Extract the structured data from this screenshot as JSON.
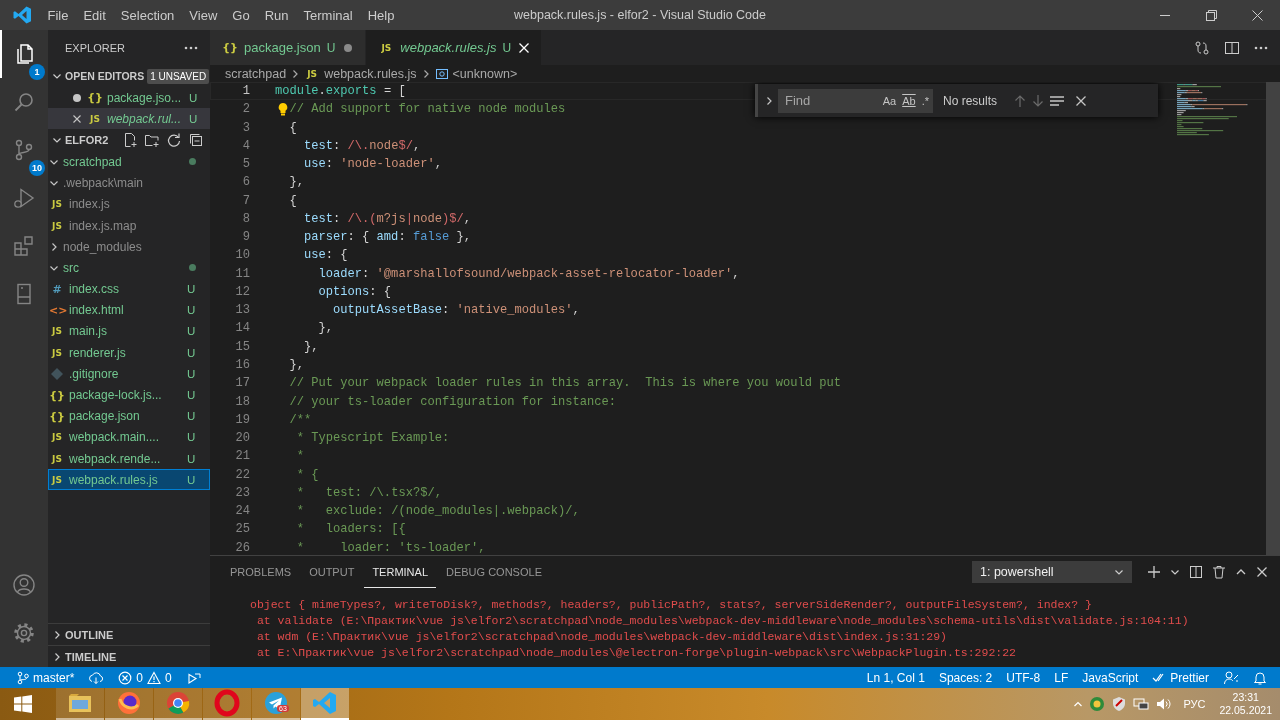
{
  "title_bar": {
    "menu": [
      "File",
      "Edit",
      "Selection",
      "View",
      "Go",
      "Run",
      "Terminal",
      "Help"
    ],
    "title": "webpack.rules.js - elfor2 - Visual Studio Code"
  },
  "activity_bar": {
    "items": [
      {
        "kind": "explorer",
        "selected": true,
        "badge": "1"
      },
      {
        "kind": "search",
        "selected": false
      },
      {
        "kind": "source_control",
        "selected": false,
        "badge": "10"
      },
      {
        "kind": "run",
        "selected": false
      },
      {
        "kind": "extensions",
        "selected": false
      },
      {
        "kind": "remote",
        "selected": false
      }
    ],
    "bottom": [
      {
        "kind": "account"
      },
      {
        "kind": "settings"
      }
    ]
  },
  "sidebar": {
    "title": "EXPLORER",
    "open_editors": {
      "label": "OPEN EDITORS",
      "expanded": true,
      "badge": "1 UNSAVED",
      "items": [
        {
          "name": "package.jso...",
          "kind": "json",
          "icon": "{}",
          "badge": "U",
          "dirty": true,
          "preview": false,
          "selected": false
        },
        {
          "name": "webpack.rul...",
          "kind": "js",
          "icon": "JS",
          "badge": "U",
          "dirty": false,
          "preview": true,
          "selected": true
        }
      ]
    },
    "folder": {
      "name": "ELFOR2",
      "expanded": true,
      "tree": [
        {
          "name": "scratchpad",
          "kind": "folder",
          "expanded": true,
          "ignored": false,
          "dot": true,
          "selected": false,
          "children": [
            {
              "name": ".webpack\\main",
              "kind": "folder",
              "expanded": true,
              "ignored": true,
              "dot": false,
              "selected": false,
              "children": [
                {
                  "name": "index.js",
                  "kind": "js",
                  "icon": "JS",
                  "ignored": true,
                  "selected": false
                },
                {
                  "name": "index.js.map",
                  "kind": "js",
                  "icon": "JS",
                  "ignored": true,
                  "selected": false
                }
              ]
            },
            {
              "name": "node_modules",
              "kind": "folder",
              "expanded": false,
              "ignored": true,
              "dot": false,
              "selected": false
            },
            {
              "name": "src",
              "kind": "folder",
              "expanded": true,
              "ignored": false,
              "dot": true,
              "selected": false,
              "children": [
                {
                  "name": "index.css",
                  "kind": "css",
                  "icon": "#",
                  "ignored": false,
                  "badge": "U",
                  "selected": false
                },
                {
                  "name": "index.html",
                  "kind": "html",
                  "icon": "<>",
                  "ignored": false,
                  "badge": "U",
                  "selected": false
                },
                {
                  "name": "main.js",
                  "kind": "js",
                  "icon": "JS",
                  "ignored": false,
                  "badge": "U",
                  "selected": false
                },
                {
                  "name": "renderer.js",
                  "kind": "js",
                  "icon": "JS",
                  "ignored": false,
                  "badge": "U",
                  "selected": false
                }
              ]
            },
            {
              "name": ".gitignore",
              "kind": "git",
              "ignored": false,
              "badge": "U",
              "selected": false
            },
            {
              "name": "package-lock.js...",
              "kind": "json",
              "icon": "{}",
              "ignored": false,
              "badge": "U",
              "selected": false
            },
            {
              "name": "package.json",
              "kind": "json",
              "icon": "{}",
              "ignored": false,
              "badge": "U",
              "selected": false
            },
            {
              "name": "webpack.main....",
              "kind": "js",
              "icon": "JS",
              "ignored": false,
              "badge": "U",
              "selected": false
            },
            {
              "name": "webpack.rende...",
              "kind": "js",
              "icon": "JS",
              "ignored": false,
              "badge": "U",
              "selected": false
            },
            {
              "name": "webpack.rules.js",
              "kind": "js",
              "icon": "JS",
              "ignored": false,
              "badge": "U",
              "selected": true
            }
          ]
        }
      ]
    },
    "sections": [
      {
        "label": "OUTLINE",
        "expanded": false
      },
      {
        "label": "TIMELINE",
        "expanded": false
      }
    ]
  },
  "tabs": [
    {
      "name": "package.json",
      "kind": "json",
      "icon": "{}",
      "badge": "U",
      "dirty": true,
      "preview": false,
      "selected": false
    },
    {
      "name": "webpack.rules.js",
      "kind": "js",
      "icon": "JS",
      "badge": "U",
      "dirty": false,
      "preview": true,
      "selected": true
    }
  ],
  "breadcrumbs": [
    {
      "kind": "folder",
      "label": "scratchpad"
    },
    {
      "kind": "js",
      "icon": "JS",
      "label": "webpack.rules.js"
    },
    {
      "kind": "symbol",
      "label": "<unknown>"
    }
  ],
  "code": [
    {
      "number": "1",
      "current": true,
      "tokens": [
        {
          "kind": "var",
          "text": "module"
        },
        {
          "kind": "p",
          "text": "."
        },
        {
          "kind": "var",
          "text": "exports"
        },
        {
          "kind": "p",
          "text": " = ["
        }
      ]
    },
    {
      "number": "2",
      "current": false,
      "lightbulb": true,
      "tokens": [
        {
          "kind": "com",
          "text": "  // Add support for native node modules"
        }
      ]
    },
    {
      "number": "3",
      "current": false,
      "tokens": [
        {
          "kind": "p",
          "text": "  {"
        }
      ]
    },
    {
      "number": "4",
      "current": false,
      "tokens": [
        {
          "kind": "prop",
          "text": "    test"
        },
        {
          "kind": "p",
          "text": ": "
        },
        {
          "kind": "re",
          "text": "/\\."
        },
        {
          "kind": "str",
          "text": "node"
        },
        {
          "kind": "re",
          "text": "$/"
        },
        {
          "kind": "p",
          "text": ","
        }
      ]
    },
    {
      "number": "5",
      "current": false,
      "tokens": [
        {
          "kind": "prop",
          "text": "    use"
        },
        {
          "kind": "p",
          "text": ": "
        },
        {
          "kind": "str",
          "text": "'node-loader'"
        },
        {
          "kind": "p",
          "text": ","
        }
      ]
    },
    {
      "number": "6",
      "current": false,
      "tokens": [
        {
          "kind": "p",
          "text": "  },"
        }
      ]
    },
    {
      "number": "7",
      "current": false,
      "tokens": [
        {
          "kind": "p",
          "text": "  {"
        }
      ]
    },
    {
      "number": "8",
      "current": false,
      "tokens": [
        {
          "kind": "prop",
          "text": "    test"
        },
        {
          "kind": "p",
          "text": ": "
        },
        {
          "kind": "re",
          "text": "/\\.("
        },
        {
          "kind": "str",
          "text": "m?js"
        },
        {
          "kind": "re",
          "text": "|"
        },
        {
          "kind": "str",
          "text": "node"
        },
        {
          "kind": "re",
          "text": ")$/"
        },
        {
          "kind": "p",
          "text": ","
        }
      ]
    },
    {
      "number": "9",
      "current": false,
      "tokens": [
        {
          "kind": "prop",
          "text": "    parser"
        },
        {
          "kind": "p",
          "text": ": { "
        },
        {
          "kind": "prop",
          "text": "amd"
        },
        {
          "kind": "p",
          "text": ": "
        },
        {
          "kind": "kw",
          "text": "false"
        },
        {
          "kind": "p",
          "text": " },"
        }
      ]
    },
    {
      "number": "10",
      "current": false,
      "tokens": [
        {
          "kind": "prop",
          "text": "    use"
        },
        {
          "kind": "p",
          "text": ": {"
        }
      ]
    },
    {
      "number": "11",
      "current": false,
      "tokens": [
        {
          "kind": "prop",
          "text": "      loader"
        },
        {
          "kind": "p",
          "text": ": "
        },
        {
          "kind": "str",
          "text": "'@marshallofsound/webpack-asset-relocator-loader'"
        },
        {
          "kind": "p",
          "text": ","
        }
      ]
    },
    {
      "number": "12",
      "current": false,
      "tokens": [
        {
          "kind": "prop",
          "text": "      options"
        },
        {
          "kind": "p",
          "text": ": {"
        }
      ]
    },
    {
      "number": "13",
      "current": false,
      "tokens": [
        {
          "kind": "prop",
          "text": "        outputAssetBase"
        },
        {
          "kind": "p",
          "text": ": "
        },
        {
          "kind": "str",
          "text": "'native_modules'"
        },
        {
          "kind": "p",
          "text": ","
        }
      ]
    },
    {
      "number": "14",
      "current": false,
      "tokens": [
        {
          "kind": "p",
          "text": "      },"
        }
      ]
    },
    {
      "number": "15",
      "current": false,
      "tokens": [
        {
          "kind": "p",
          "text": "    },"
        }
      ]
    },
    {
      "number": "16",
      "current": false,
      "tokens": [
        {
          "kind": "p",
          "text": "  },"
        }
      ]
    },
    {
      "number": "17",
      "current": false,
      "tokens": [
        {
          "kind": "com",
          "text": "  // Put your webpack loader rules in this array.  This is where you would put"
        }
      ]
    },
    {
      "number": "18",
      "current": false,
      "tokens": [
        {
          "kind": "com",
          "text": "  // your ts-loader configuration for instance:"
        }
      ]
    },
    {
      "number": "19",
      "current": false,
      "tokens": [
        {
          "kind": "com",
          "text": "  /**"
        }
      ]
    },
    {
      "number": "20",
      "current": false,
      "tokens": [
        {
          "kind": "com",
          "text": "   * Typescript Example:"
        }
      ]
    },
    {
      "number": "21",
      "current": false,
      "tokens": [
        {
          "kind": "com",
          "text": "   *"
        }
      ]
    },
    {
      "number": "22",
      "current": false,
      "tokens": [
        {
          "kind": "com",
          "text": "   * {"
        }
      ]
    },
    {
      "number": "23",
      "current": false,
      "tokens": [
        {
          "kind": "com",
          "text": "   *   test: /\\.tsx?$/,"
        }
      ]
    },
    {
      "number": "24",
      "current": false,
      "tokens": [
        {
          "kind": "com",
          "text": "   *   exclude: /(node_modules|.webpack)/,"
        }
      ]
    },
    {
      "number": "25",
      "current": false,
      "tokens": [
        {
          "kind": "com",
          "text": "   *   loaders: [{"
        }
      ]
    },
    {
      "number": "26",
      "current": false,
      "tokens": [
        {
          "kind": "com",
          "text": "   *     loader: 'ts-loader',"
        }
      ]
    }
  ],
  "find_widget": {
    "placeholder": "Find",
    "toggles": [
      "Aa",
      "Ab",
      ".*"
    ],
    "result": "No results"
  },
  "panel": {
    "tabs": [
      {
        "label": "PROBLEMS",
        "selected": false
      },
      {
        "label": "OUTPUT",
        "selected": false
      },
      {
        "label": "TERMINAL",
        "selected": true
      },
      {
        "label": "DEBUG CONSOLE",
        "selected": false
      }
    ],
    "terminal_select": "1: powershell",
    "lines": [
      "object { mimeTypes?, writeToDisk?, methods?, headers?, publicPath?, stats?, serverSideRender?, outputFileSystem?, index? }",
      " at validate (E:\\Практик\\vue js\\elfor2\\scratchpad\\node_modules\\webpack-dev-middleware\\node_modules\\schema-utils\\dist\\validate.js:104:11)",
      " at wdm (E:\\Практик\\vue js\\elfor2\\scratchpad\\node_modules\\webpack-dev-middleware\\dist\\index.js:31:29)",
      " at E:\\Практик\\vue js\\elfor2\\scratchpad\\node_modules\\@electron-forge\\plugin-webpack\\src\\WebpackPlugin.ts:292:22"
    ]
  },
  "status_bar": {
    "branch": "master*",
    "errors": "0",
    "warnings": "0",
    "right": [
      "Ln 1, Col 1",
      "Spaces: 2",
      "UTF-8",
      "LF",
      "JavaScript"
    ],
    "prettier": "Prettier"
  },
  "taskbar": {
    "apps": [
      {
        "kind": "file_explorer",
        "selected": false
      },
      {
        "kind": "firefox",
        "selected": false
      },
      {
        "kind": "chrome",
        "selected": false
      },
      {
        "kind": "opera",
        "selected": false
      },
      {
        "kind": "telegram",
        "selected": false,
        "badge": "63"
      },
      {
        "kind": "vscode",
        "selected": true
      }
    ],
    "tray": {
      "language": "РУС",
      "time": "23:31",
      "date": "22.05.2021"
    }
  }
}
